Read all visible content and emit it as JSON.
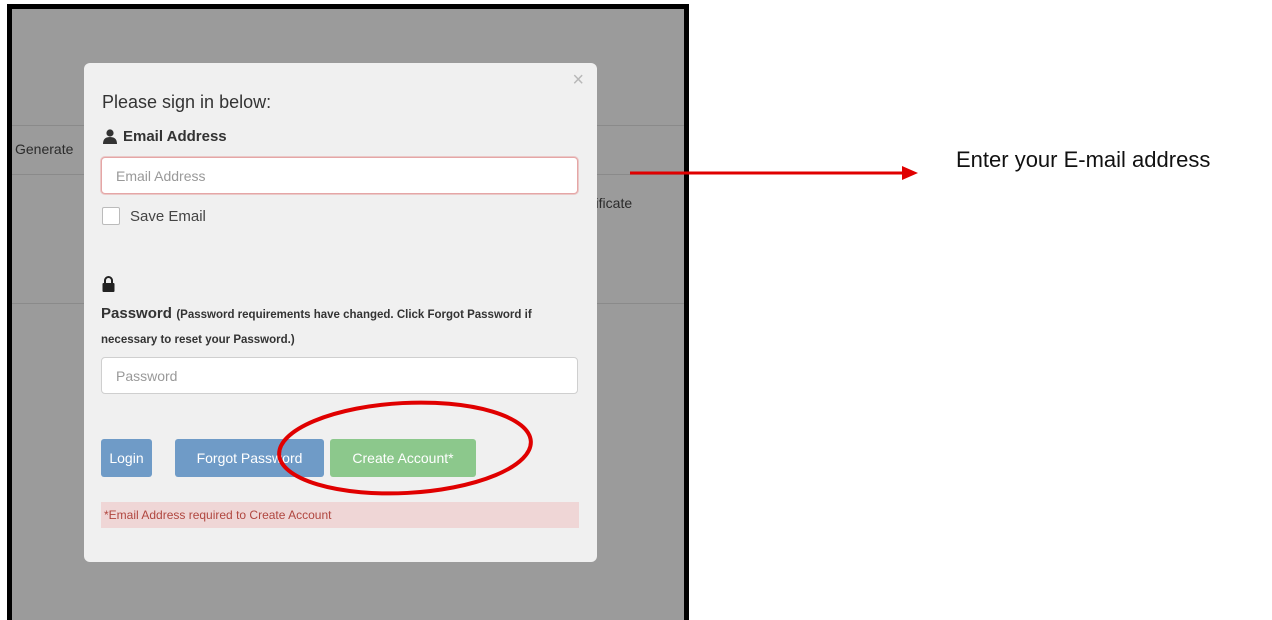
{
  "background": {
    "nav_label": "Generate",
    "cert_fragment": "rtificate"
  },
  "modal": {
    "title": "Please sign in below:",
    "email_label": "Email Address",
    "email_placeholder": "Email Address",
    "save_email_label": "Save Email",
    "password_label": "Password",
    "password_note": "(Password requirements have changed. Click Forgot Password if necessary to reset your Password.)",
    "password_placeholder": "Password",
    "buttons": {
      "login": "Login",
      "forgot": "Forgot Password",
      "create": "Create Account*"
    },
    "alert": "*Email Address required to Create Account",
    "close_symbol": "×"
  },
  "annotation": {
    "text": "Enter your E-mail address",
    "color": "#e00000"
  },
  "colors": {
    "primary_button": "#6f9bc7",
    "success_button": "#8cc88c",
    "alert_bg": "#efd6d6",
    "alert_text": "#b0463f"
  }
}
